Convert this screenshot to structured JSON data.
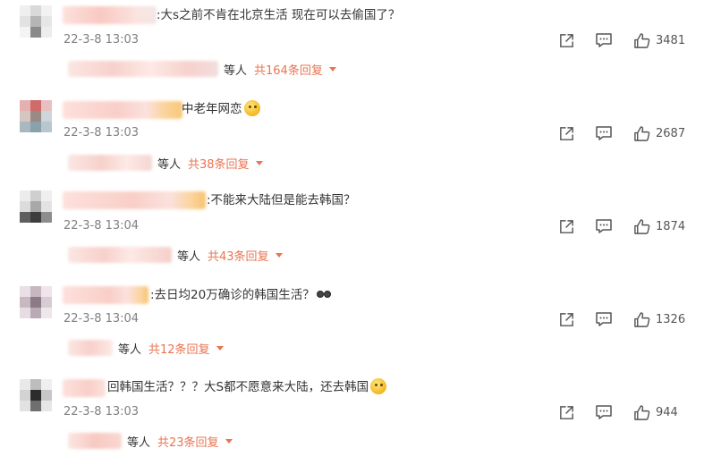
{
  "comments": [
    {
      "text": ":大s之前不肯在北京生活 现在可以去偷国了？",
      "emoji": "",
      "time": "22-3-8 13:03",
      "likes": "3481",
      "reply_people": "等人",
      "reply_total": "共164条回复"
    },
    {
      "text": "中老年网恋",
      "emoji": "crying-laughing-emoji",
      "time": "22-3-8 13:03",
      "likes": "2687",
      "reply_people": "等人",
      "reply_total": "共38条回复"
    },
    {
      "text": ":不能来大陆但是能去韩国？",
      "emoji": "",
      "time": "22-3-8 13:04",
      "likes": "1874",
      "reply_people": "等人",
      "reply_total": "共43条回复"
    },
    {
      "text": ":去日均20万确诊的韩国生活？",
      "emoji": "sunglasses-emoji",
      "time": "22-3-8 13:04",
      "likes": "1326",
      "reply_people": "等人",
      "reply_total": "共12条回复"
    },
    {
      "text": "回韩国生活？？？大S都不愿意来大陆，还去韩国",
      "emoji": "sweat-emoji",
      "time": "22-3-8 13:03",
      "likes": "944",
      "reply_people": "等人",
      "reply_total": "共23条回复"
    }
  ],
  "icons": {
    "share": "share-icon",
    "comment": "comment-icon",
    "like": "thumbs-up-icon",
    "expand": "caret-down-icon"
  },
  "colors": {
    "accent": "#eb7350",
    "time": "#808080",
    "text": "#333333",
    "icon": "#555555"
  }
}
